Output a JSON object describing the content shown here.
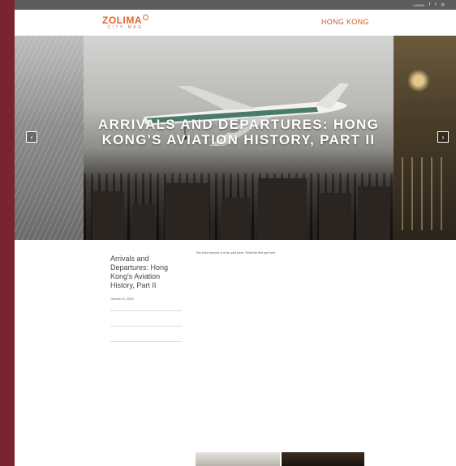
{
  "topbar": {
    "link": "LOGIN",
    "icons": [
      "facebook-icon",
      "twitter-icon",
      "instagram-icon"
    ]
  },
  "header": {
    "brand": "ZOLIMA",
    "brand_sub": "CITY MAG",
    "partner": "HONG KONG",
    "partner_sub": ""
  },
  "hero": {
    "title": "ARRIVALS AND DEPARTURES: HONG KONG'S AVIATION HISTORY, PART II",
    "byline": "",
    "prev_icon": "chevron-left-icon",
    "next_icon": "chevron-right-icon"
  },
  "sidebar": {
    "breadcrumbs": [
      "",
      "",
      ""
    ],
    "title": "Arrivals and Departures: Hong Kong's Aviation History, Part II",
    "date": "October 8, 2020",
    "sections": [
      {
        "heading": "",
        "text": ""
      },
      {
        "heading": "",
        "text": ""
      },
      {
        "heading": "",
        "text": ""
      }
    ]
  },
  "article": {
    "intro": "This is the second of a two-part piece. Read the first part here.",
    "paragraphs": [
      {
        "text": ""
      },
      {
        "text": ""
      },
      {
        "text": ""
      },
      {
        "text": ""
      },
      {
        "text": ""
      }
    ]
  },
  "colors": {
    "accent": "#e8632b",
    "sidebar_bg": "#7a2430",
    "topbar": "#5d5d5d",
    "link": "#c89a2a"
  }
}
